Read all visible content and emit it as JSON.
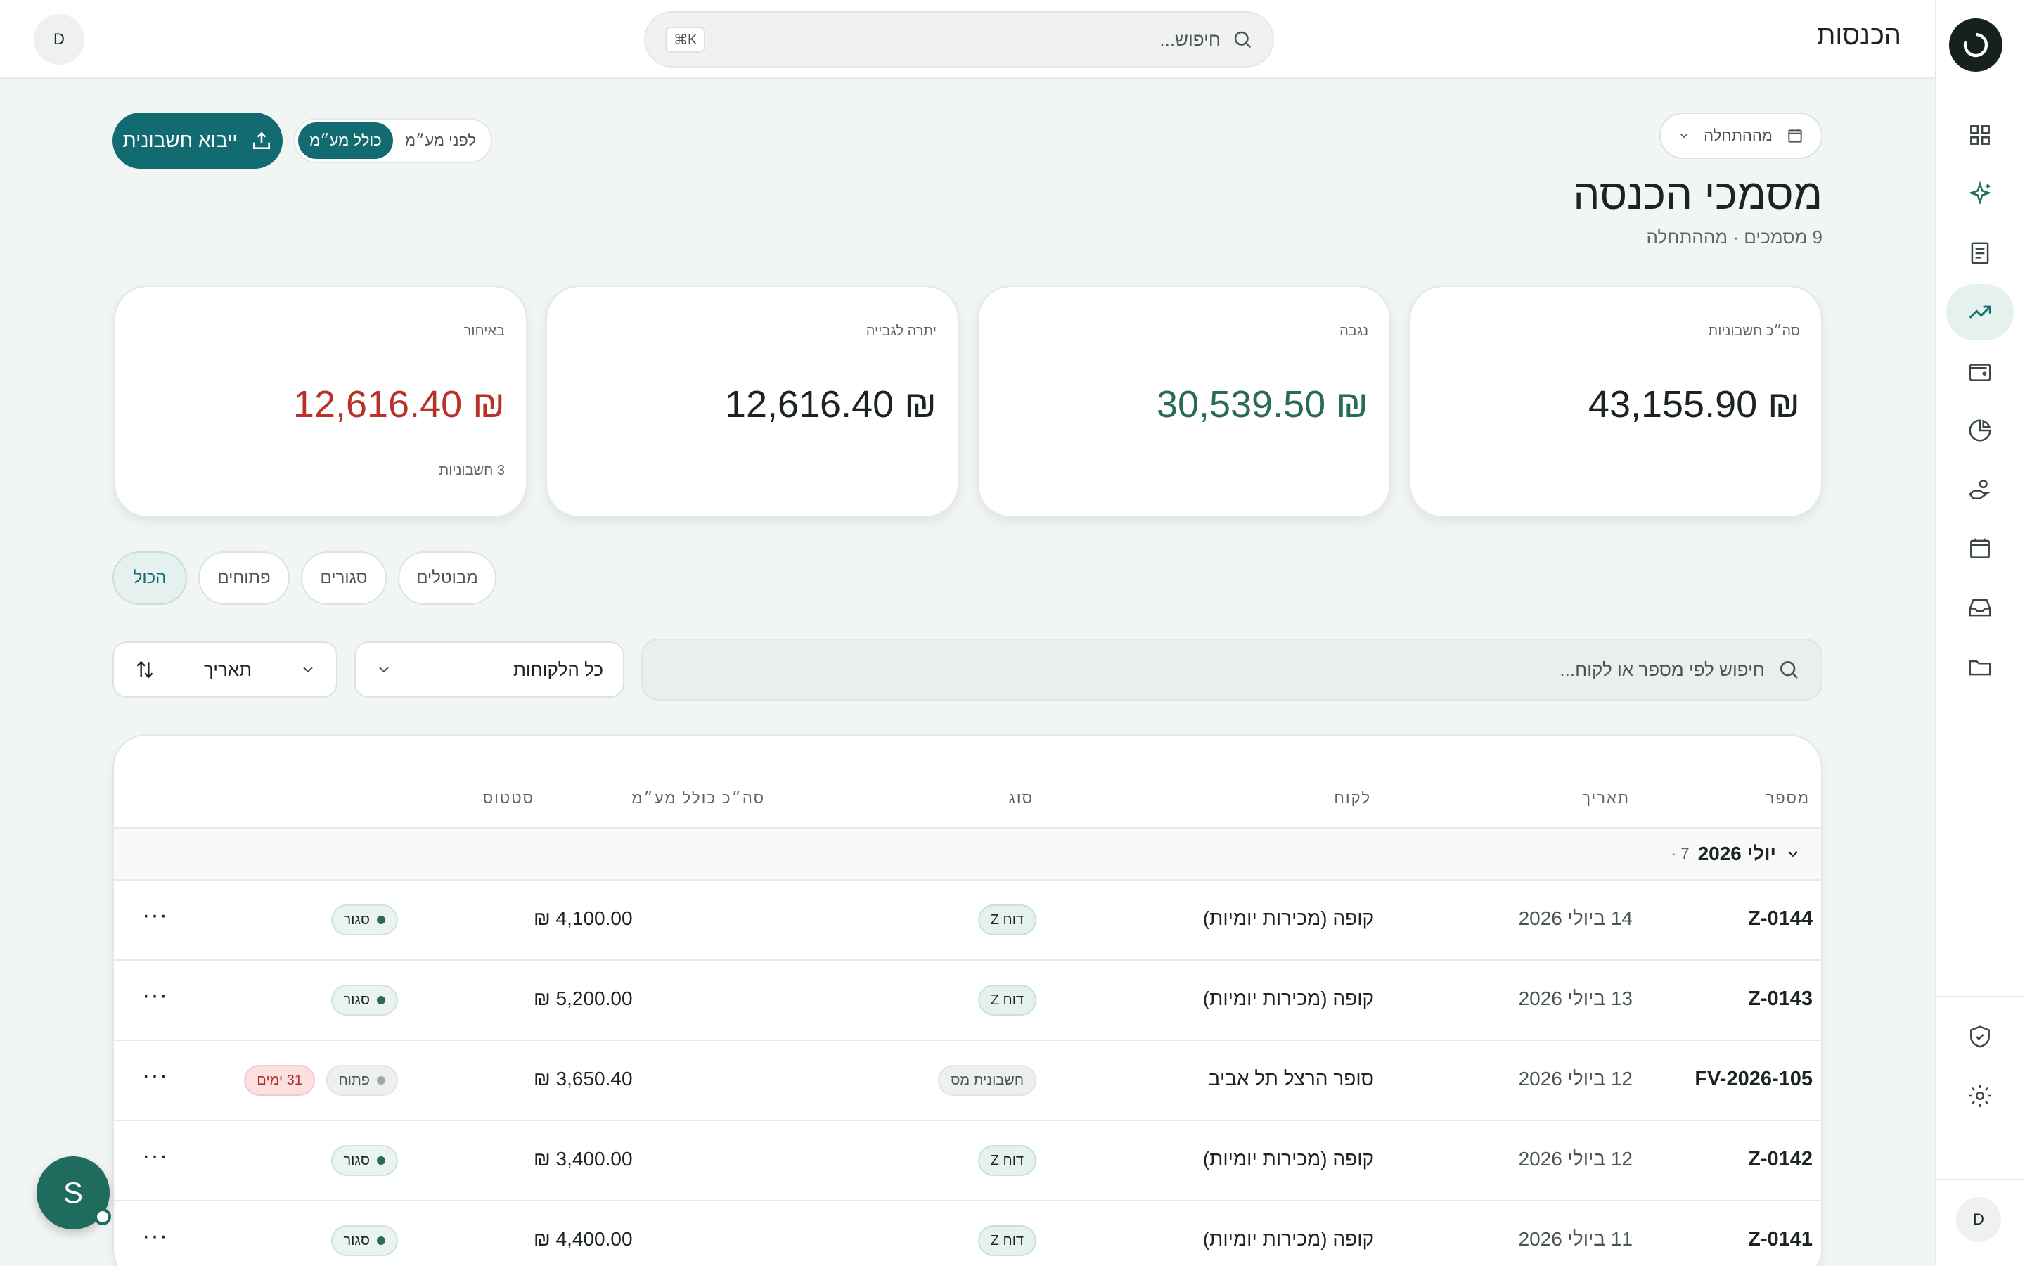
{
  "app": {
    "title": "הכנסות",
    "user_initial": "D"
  },
  "search": {
    "placeholder": "חיפוש...",
    "shortcut": "⌘K"
  },
  "sidebar": {
    "items": [
      {
        "icon": "grid-icon"
      },
      {
        "icon": "sparkle-icon"
      },
      {
        "icon": "document-icon"
      },
      {
        "icon": "trending-up-icon",
        "active": true
      },
      {
        "icon": "wallet-icon"
      },
      {
        "icon": "pie-chart-icon"
      },
      {
        "icon": "hand-coin-icon"
      },
      {
        "icon": "calendar-icon"
      },
      {
        "icon": "inbox-icon"
      },
      {
        "icon": "folder-icon"
      }
    ],
    "bottom_items": [
      {
        "icon": "shield-check-icon"
      },
      {
        "icon": "gear-icon"
      }
    ],
    "user_initial": "D"
  },
  "header": {
    "date_filter": "מההתחלה",
    "title": "מסמכי הכנסה",
    "subtitle": "9 מסמכים · מההתחלה",
    "vat_toggle": {
      "before": "לפני מע״מ",
      "including": "כולל מע״מ",
      "selected": "including"
    },
    "import_button": "ייבוא חשבונית"
  },
  "stats": {
    "total": {
      "label": "סה״כ חשבוניות",
      "value": "₪ 43,155.90"
    },
    "collected": {
      "label": "נגבה",
      "value": "₪ 30,539.50"
    },
    "balance": {
      "label": "יתרה לגבייה",
      "value": "₪ 12,616.40"
    },
    "overdue": {
      "label": "באיחור",
      "value": "₪ 12,616.40",
      "footnote": "3 חשבוניות"
    }
  },
  "filters": {
    "tabs": [
      {
        "label": "הכול",
        "active": true
      },
      {
        "label": "פתוחים"
      },
      {
        "label": "סגורים"
      },
      {
        "label": "מבוטלים"
      }
    ],
    "search_placeholder": "חיפוש לפי מספר או לקוח...",
    "customer_select": "כל הלקוחות",
    "sort_select": "תאריך"
  },
  "table": {
    "headers": {
      "number": "מספר",
      "date": "תאריך",
      "customer": "לקוח",
      "type": "סוג",
      "total": "סה״כ כולל מע״מ",
      "status": "סטטוס"
    },
    "group": {
      "label": "יולי 2026",
      "count": "7 ·"
    },
    "rows": [
      {
        "number": "Z-0144",
        "date": "14 ביולי 2026",
        "customer": "קופה (מכירות יומיות)",
        "type": "דוח Z",
        "amount": "₪ 4,100.00",
        "status": "סגור"
      },
      {
        "number": "Z-0143",
        "date": "13 ביולי 2026",
        "customer": "קופה (מכירות יומיות)",
        "type": "דוח Z",
        "amount": "₪ 5,200.00",
        "status": "סגור"
      },
      {
        "number": "FV-2026-105",
        "date": "12 ביולי 2026",
        "customer": "סופר הרצל תל אביב",
        "type": "חשבונית מס",
        "amount": "₪ 3,650.40",
        "status": "פתוח",
        "days": "31 ימים"
      },
      {
        "number": "Z-0142",
        "date": "12 ביולי 2026",
        "customer": "קופה (מכירות יומיות)",
        "type": "דוח Z",
        "amount": "₪ 3,400.00",
        "status": "סגור"
      },
      {
        "number": "Z-0141",
        "date": "11 ביולי 2026",
        "customer": "קופה (מכירות יומיות)",
        "type": "דוח Z",
        "amount": "₪ 4,400.00",
        "status": "סגור"
      }
    ],
    "more_label": "···"
  },
  "chat": {
    "initial": "S"
  },
  "colors": {
    "accent": "#126b70",
    "collected": "#2a6b55",
    "overdue": "#b8322b",
    "background": "#f1f5f3"
  }
}
